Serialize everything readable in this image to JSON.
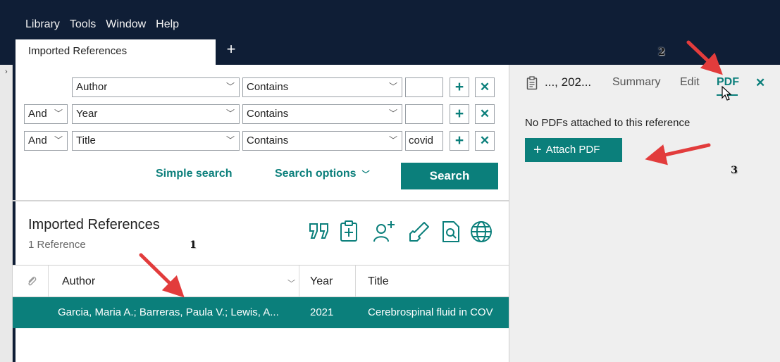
{
  "menu": [
    "Library",
    "Tools",
    "Window",
    "Help"
  ],
  "tabs": {
    "active": "Imported References",
    "add": "+"
  },
  "search": {
    "rows": [
      {
        "connector": "",
        "field": "Author",
        "operator": "Contains",
        "value": ""
      },
      {
        "connector": "And",
        "field": "Year",
        "operator": "Contains",
        "value": ""
      },
      {
        "connector": "And",
        "field": "Title",
        "operator": "Contains",
        "value": "covid"
      }
    ],
    "add_label": "+",
    "remove_label": "✕",
    "simple_search": "Simple search",
    "search_options": "Search options",
    "search_button": "Search"
  },
  "library": {
    "title": "Imported References",
    "count": "1 Reference",
    "toolbar_icons": [
      "quote-icon",
      "clipboard-icon",
      "add-person-icon",
      "export-arrow-icon",
      "find-pdf-icon",
      "globe-icon"
    ]
  },
  "table": {
    "columns": [
      "Author",
      "Year",
      "Title"
    ],
    "rows": [
      {
        "author": "Garcia, Maria A.; Barreras, Paula V.; Lewis, A...",
        "year": "2021",
        "title": "Cerebrospinal fluid in COV"
      }
    ]
  },
  "panel": {
    "ref_short": "..., 202...",
    "tabs": [
      "Summary",
      "Edit",
      "PDF"
    ],
    "active_tab": "PDF",
    "close": "✕",
    "message": "No PDFs attached to this reference",
    "attach_label": "Attach PDF",
    "attach_plus": "+"
  },
  "annotations": [
    "1",
    "2",
    "3"
  ],
  "colors": {
    "accent": "#0b7f7b",
    "dark": "#0f1e36",
    "annotation": "#e23c3c"
  }
}
